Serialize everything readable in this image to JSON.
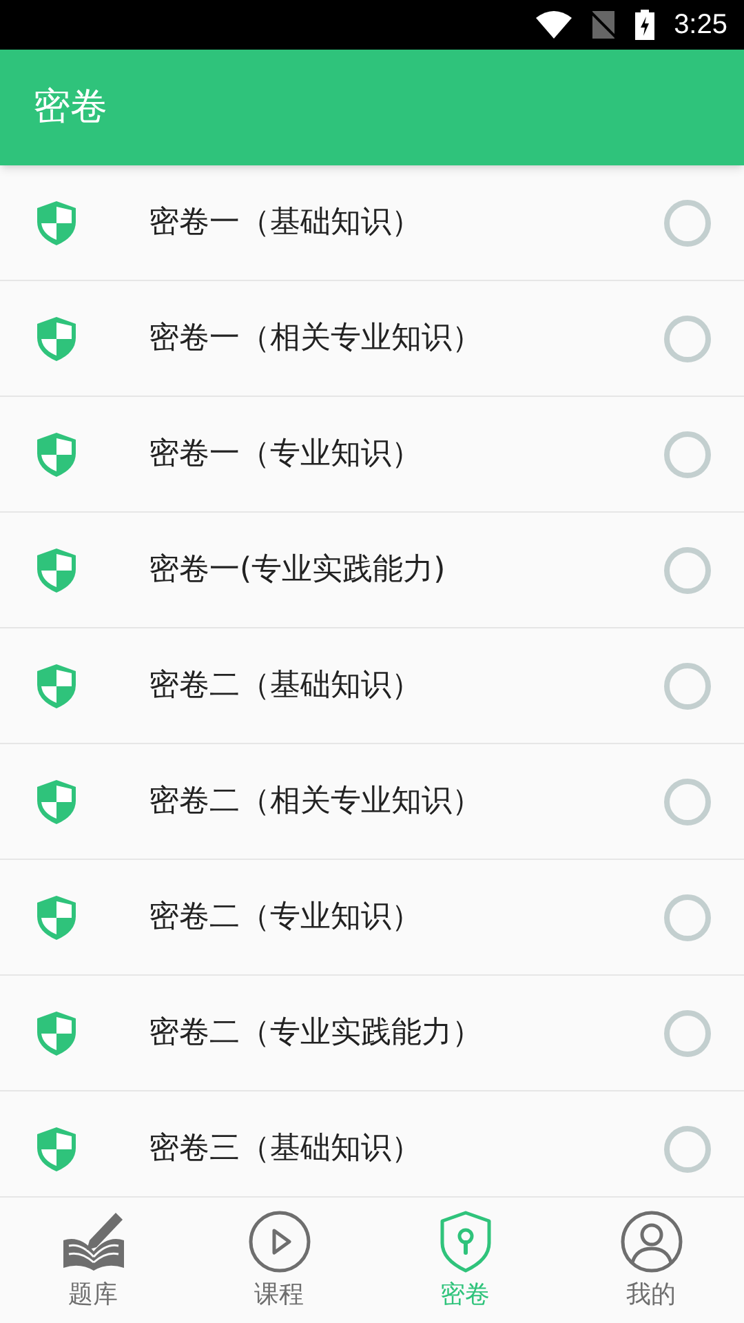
{
  "status_bar": {
    "time": "3:25"
  },
  "header": {
    "title": "密卷"
  },
  "papers": [
    {
      "title": "密卷一（基础知识）",
      "selected": false
    },
    {
      "title": "密卷一（相关专业知识）",
      "selected": false
    },
    {
      "title": "密卷一（专业知识）",
      "selected": false
    },
    {
      "title": "密卷一(专业实践能力)",
      "selected": false
    },
    {
      "title": "密卷二（基础知识）",
      "selected": false
    },
    {
      "title": "密卷二（相关专业知识）",
      "selected": false
    },
    {
      "title": "密卷二（专业知识）",
      "selected": false
    },
    {
      "title": "密卷二（专业实践能力）",
      "selected": false
    },
    {
      "title": "密卷三（基础知识）",
      "selected": false
    }
  ],
  "bottom_nav": [
    {
      "kind": "bank",
      "label": "题库",
      "selected": false
    },
    {
      "kind": "course",
      "label": "课程",
      "selected": false
    },
    {
      "kind": "paper",
      "label": "密卷",
      "selected": true
    },
    {
      "kind": "profile",
      "label": "我的",
      "selected": false
    }
  ]
}
